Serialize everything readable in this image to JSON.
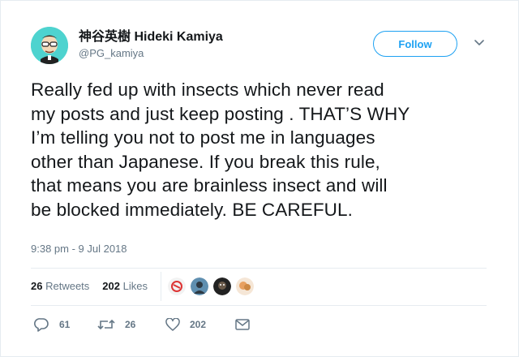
{
  "author": {
    "display_name": "神谷英樹 Hideki Kamiya",
    "handle": "@PG_kamiya"
  },
  "follow_button": {
    "label": "Follow"
  },
  "tweet": {
    "lines": [
      "Really fed up with insects which never read",
      "my posts and just keep posting . THAT’S WHY",
      "I’m telling you not to post me in languages",
      "other than Japanese. If you break this rule,",
      "that means you are brainless insect and will",
      "be blocked immediately. BE CAREFUL."
    ],
    "timestamp": "9:38 pm - 9 Jul 2018"
  },
  "stats": {
    "retweets_count": "26",
    "retweets_label": "Retweets",
    "likes_count": "202",
    "likes_label": "Likes"
  },
  "actions": {
    "reply_count": "61",
    "retweet_count": "26",
    "like_count": "202"
  },
  "colors": {
    "accent": "#1da1f2",
    "secondary_text": "#657786",
    "avatar_bg": "#4ed3cf"
  },
  "icons": [
    "chevron-down-icon",
    "reply-icon",
    "retweet-icon",
    "heart-icon",
    "envelope-icon"
  ]
}
